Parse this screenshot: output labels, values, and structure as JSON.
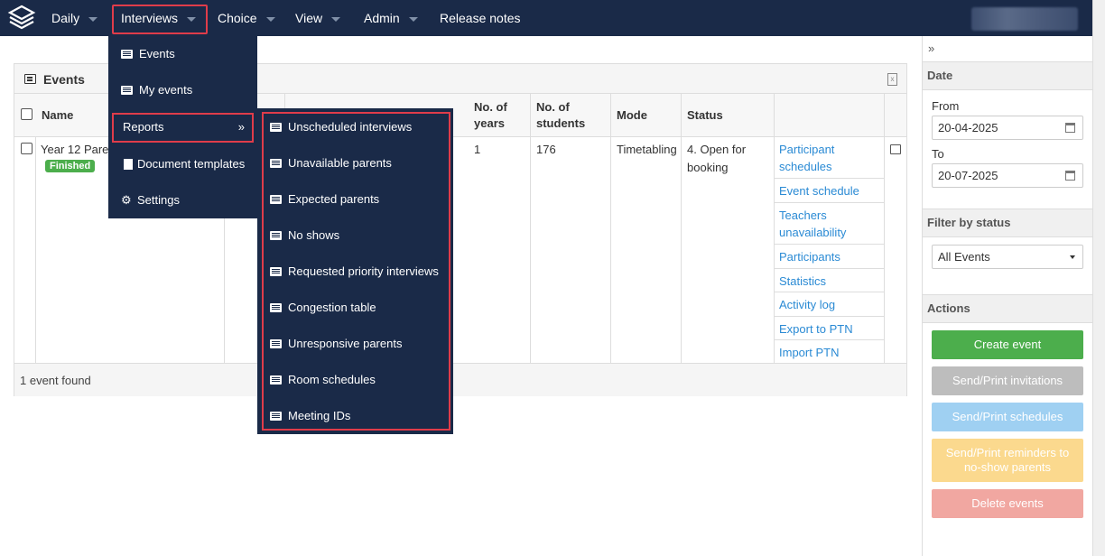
{
  "nav": {
    "items": [
      {
        "label": "Daily"
      },
      {
        "label": "Interviews"
      },
      {
        "label": "Choice"
      },
      {
        "label": "View"
      },
      {
        "label": "Admin"
      },
      {
        "label": "Release notes"
      }
    ]
  },
  "interviews_menu": {
    "items": [
      "Events",
      "My events"
    ],
    "reports": {
      "label": "Reports",
      "arrow": "»"
    },
    "document_templates": "Document templates",
    "settings": "Settings"
  },
  "reports_menu": {
    "items": [
      "Unscheduled interviews",
      "Unavailable parents",
      "Expected parents",
      "No shows",
      "Requested priority interviews",
      "Congestion table",
      "Unresponsive parents",
      "Room schedules",
      "Meeting IDs"
    ]
  },
  "events_panel": {
    "title": "Events",
    "columns": {
      "name": "Name",
      "years": "No. of years",
      "students": "No. of students",
      "mode": "Mode",
      "status": "Status"
    },
    "row": {
      "name": "Year 12 Parer",
      "badge": "Finished",
      "years": "1",
      "students": "176",
      "mode": "Timetabling",
      "status": "4. Open for booking",
      "links": [
        "Participant schedules",
        "Event schedule",
        "Teachers unavailability",
        "Participants",
        "Statistics",
        "Activity log",
        "Export to PTN",
        "Import PTN"
      ]
    },
    "footer": "1 event found"
  },
  "sidebar": {
    "toggle": "»",
    "date_head": "Date",
    "from_label": "From",
    "from_value": "20-04-2025",
    "to_label": "To",
    "to_value": "20-07-2025",
    "filter_head": "Filter by status",
    "filter_value": "All Events",
    "actions_head": "Actions",
    "buttons": [
      {
        "label": "Create event",
        "color": "#4cae4c"
      },
      {
        "label": "Send/Print invitations",
        "color": "#bdbdbd"
      },
      {
        "label": "Send/Print schedules",
        "color": "#9fd0f2"
      },
      {
        "label": "Send/Print reminders to no-show parents",
        "color": "#fbd98e"
      },
      {
        "label": "Delete events",
        "color": "#f1a7a1"
      }
    ]
  }
}
